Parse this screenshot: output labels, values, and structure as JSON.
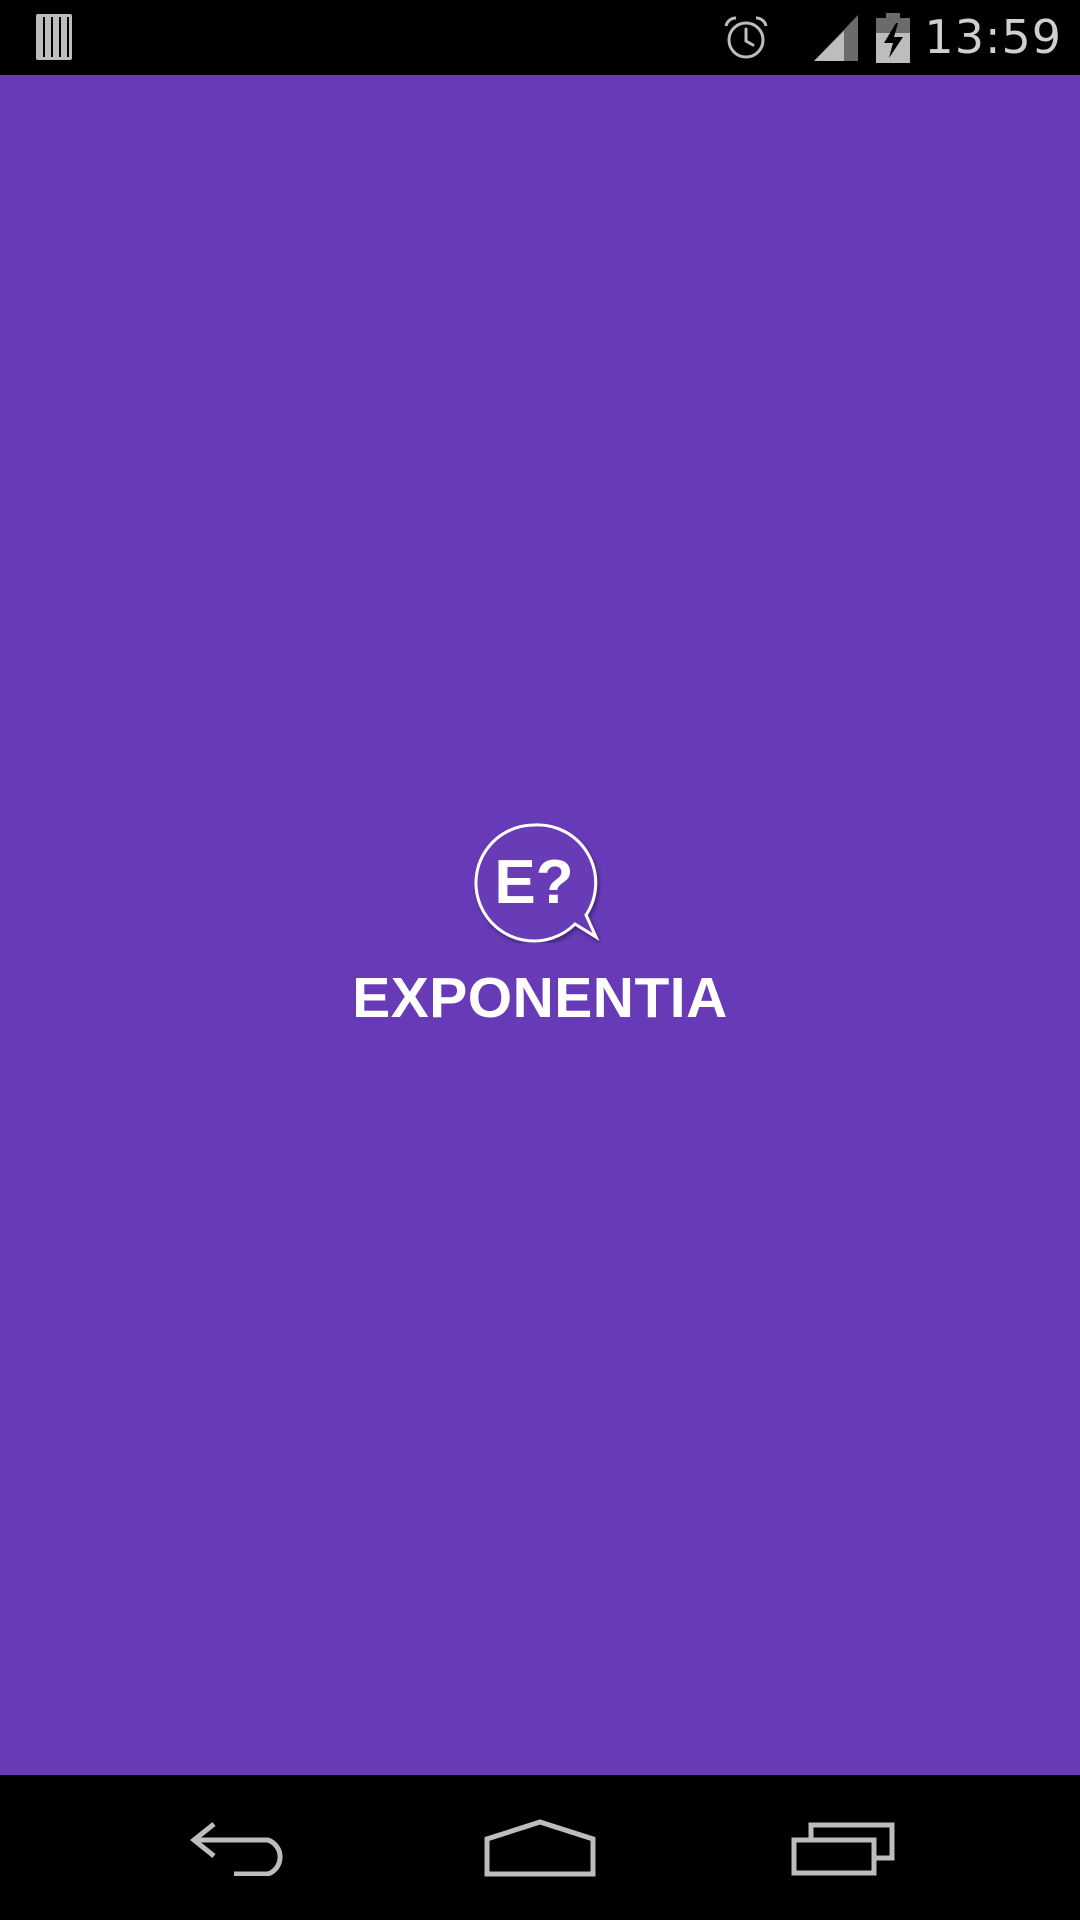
{
  "status_bar": {
    "time": "13:59",
    "icons": [
      "notification-stack-icon",
      "alarm-icon",
      "signal-icon",
      "battery-charging-icon"
    ]
  },
  "splash": {
    "background_color": "#673ab7",
    "logo": {
      "icon": "speech-bubble-logo-icon",
      "text": "E?"
    },
    "app_name": "EXPONENTIA"
  },
  "nav_bar": {
    "buttons": [
      "back-icon",
      "home-icon",
      "recents-icon"
    ]
  }
}
